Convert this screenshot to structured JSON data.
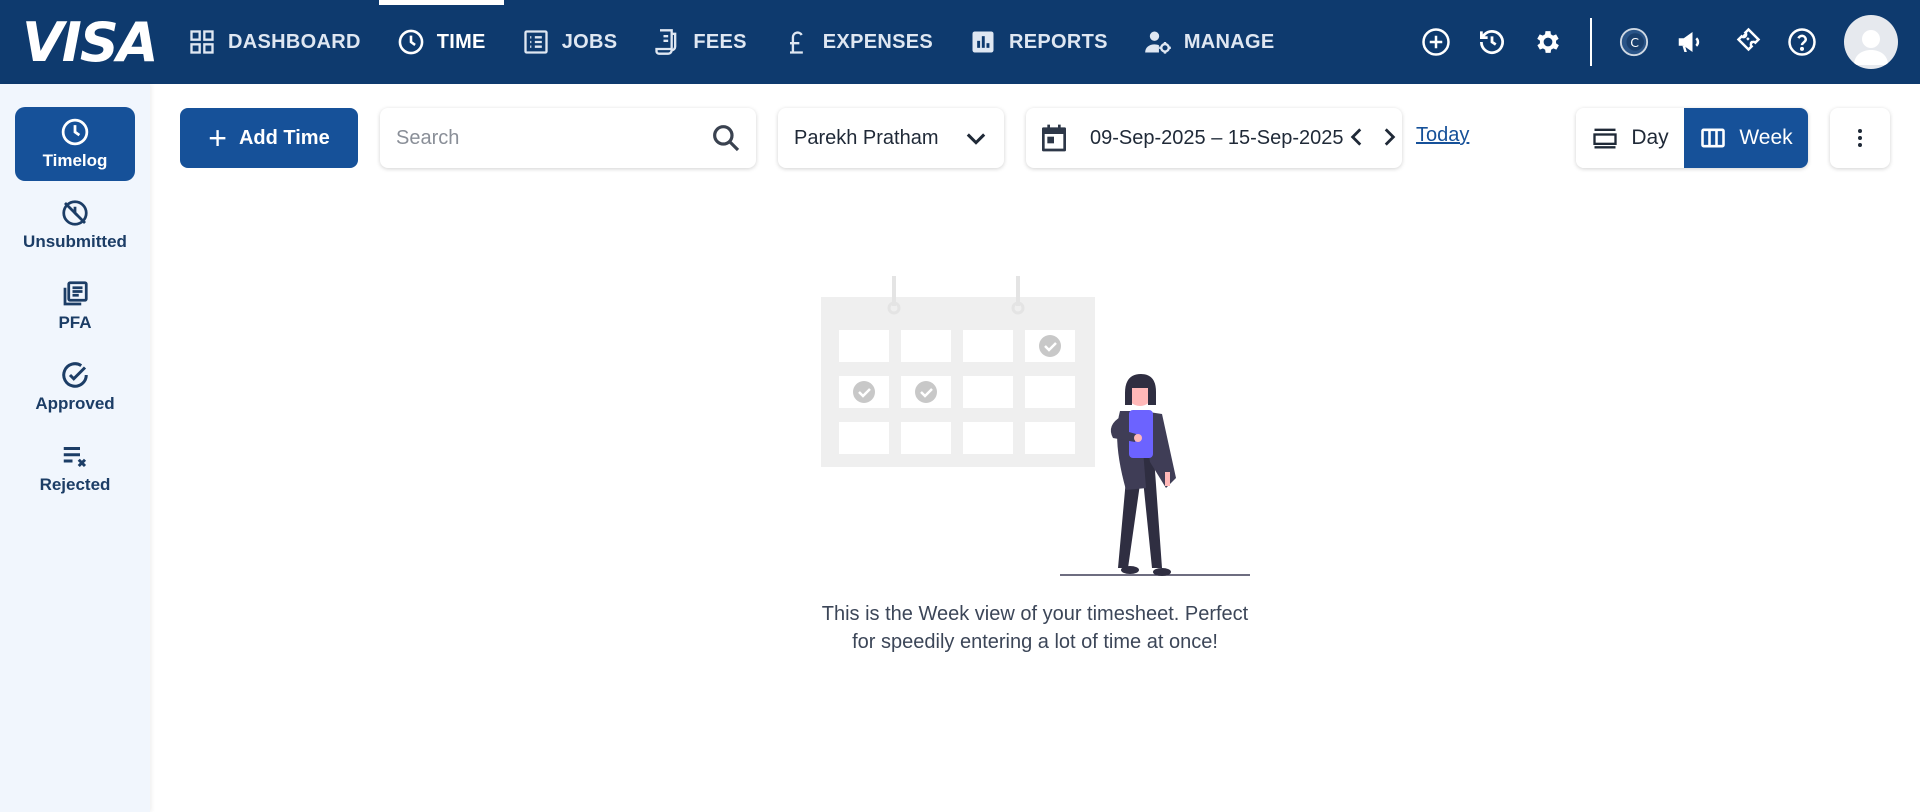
{
  "brand": {
    "logo_text": "VISA"
  },
  "nav": {
    "items": [
      {
        "label": "DASHBOARD",
        "icon": "grid-icon"
      },
      {
        "label": "TIME",
        "icon": "clock-icon",
        "active": true
      },
      {
        "label": "JOBS",
        "icon": "list-icon"
      },
      {
        "label": "FEES",
        "icon": "receipt-icon"
      },
      {
        "label": "EXPENSES",
        "icon": "pound-icon"
      },
      {
        "label": "REPORTS",
        "icon": "bar-chart-icon"
      },
      {
        "label": "MANAGE",
        "icon": "user-gear-icon"
      }
    ]
  },
  "top_icons": [
    "add-circle-icon",
    "history-icon",
    "settings-icon",
    "c-logo-icon",
    "megaphone-icon",
    "ticket-icon",
    "help-icon",
    "avatar-icon"
  ],
  "sidebar": {
    "items": [
      {
        "label": "Timelog",
        "icon": "clock-icon",
        "active": true
      },
      {
        "label": "Unsubmitted",
        "icon": "unsubmitted-icon"
      },
      {
        "label": "PFA",
        "icon": "documents-icon"
      },
      {
        "label": "Approved",
        "icon": "check-circle-icon"
      },
      {
        "label": "Rejected",
        "icon": "list-x-icon"
      }
    ]
  },
  "toolbar": {
    "add_time_label": "Add Time",
    "search_placeholder": "Search",
    "user_selected": "Parekh Pratham",
    "date_range": "09-Sep-2025 – 15-Sep-2025",
    "today_label": "Today",
    "view_day_label": "Day",
    "view_week_label": "Week",
    "active_view": "Week"
  },
  "empty_state": {
    "line1": "This is the Week view of your timesheet. Perfect",
    "line2": "for speedily entering a lot of time at once!"
  },
  "colors": {
    "nav_bg": "#0e3a6e",
    "primary": "#165199",
    "sidebar_bg": "#f1f6fd",
    "illustration_accent": "#6c63ff"
  }
}
